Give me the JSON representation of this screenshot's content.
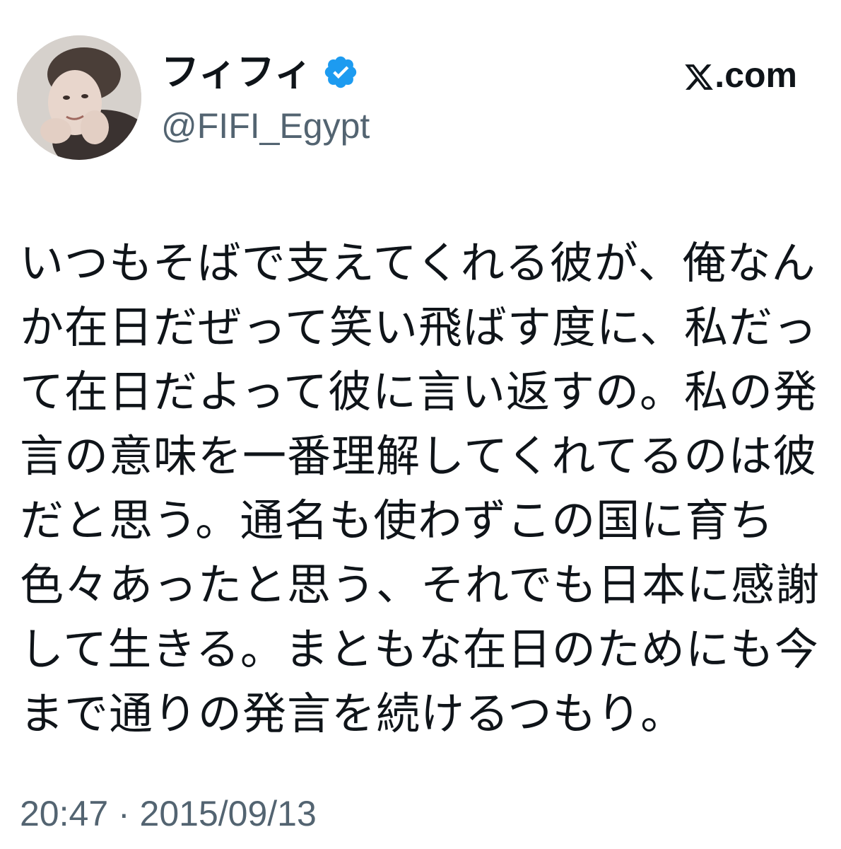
{
  "tweet": {
    "display_name": "フィフィ",
    "verified": true,
    "handle": "@FIFI_Egypt",
    "site": ".com",
    "site_icon": "x-logo-icon",
    "verified_color": "#1d9bf0",
    "text_lines": [
      "いつもそばで支えてくれる彼が、俺なん",
      "か在日だぜって笑い飛ばす度に、私だっ",
      "て在日だよって彼に言い返すの。私の発",
      "言の意味を一番理解してくれてるのは彼",
      "だと思う。通名も使わずこの国に育ち",
      "色々あったと思う、それでも日本に感謝",
      "して生きる。まともな在日のためにも今",
      "まで通りの発言を続けるつもり。"
    ],
    "timestamp": "20:47 · 2015/09/13"
  }
}
